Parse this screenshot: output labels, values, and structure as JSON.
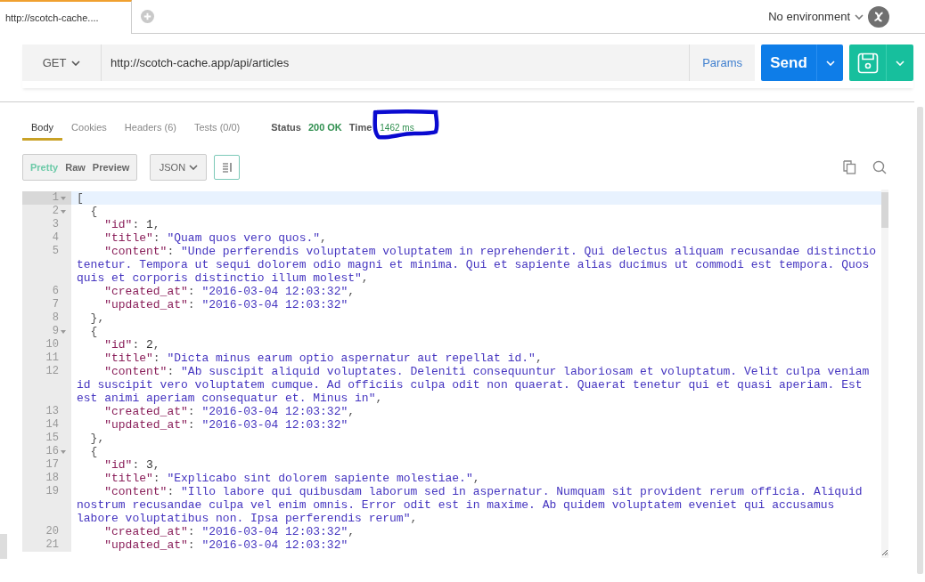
{
  "request_tabs": [
    {
      "label": "http://scotch-cache....",
      "selected": true
    }
  ],
  "environment": {
    "label": "No environment"
  },
  "request": {
    "method": "GET",
    "url": "http://scotch-cache.app/api/articles",
    "params_label": "Params",
    "send_label": "Send"
  },
  "response": {
    "tabs": [
      {
        "label": "Body",
        "selected": true
      },
      {
        "label": "Cookies",
        "selected": false
      },
      {
        "label": "Headers (6)",
        "selected": false
      },
      {
        "label": "Tests (0/0)",
        "selected": false
      }
    ],
    "status_label": "Status",
    "status_value": "200 OK",
    "time_label": "Time",
    "time_value": "1462 ms",
    "view_modes": [
      {
        "label": "Pretty",
        "selected": true
      },
      {
        "label": "Raw",
        "selected": false
      },
      {
        "label": "Preview",
        "selected": false
      }
    ],
    "format": "JSON",
    "lines": [
      {
        "number": "1",
        "fold": true,
        "active": true,
        "rows": [
          {
            "tokens": [
              {
                "kind": "punct",
                "text": "["
              }
            ]
          }
        ]
      },
      {
        "number": "2",
        "fold": true,
        "active": false,
        "rows": [
          {
            "tokens": [
              {
                "kind": "punct",
                "text": "  {"
              }
            ]
          }
        ]
      },
      {
        "number": "3",
        "fold": false,
        "active": false,
        "rows": [
          {
            "tokens": [
              {
                "kind": "key",
                "text": "    \"id\""
              },
              {
                "kind": "punct",
                "text": ": "
              },
              {
                "kind": "number",
                "text": "1"
              },
              {
                "kind": "punct",
                "text": ","
              }
            ]
          }
        ]
      },
      {
        "number": "4",
        "fold": false,
        "active": false,
        "rows": [
          {
            "tokens": [
              {
                "kind": "key",
                "text": "    \"title\""
              },
              {
                "kind": "punct",
                "text": ": "
              },
              {
                "kind": "string",
                "text": "\"Quam quos vero quos.\""
              },
              {
                "kind": "punct",
                "text": ","
              }
            ]
          }
        ]
      },
      {
        "number": "5",
        "fold": false,
        "active": false,
        "rows": [
          {
            "tokens": [
              {
                "kind": "key",
                "text": "    \"content\""
              },
              {
                "kind": "punct",
                "text": ": "
              },
              {
                "kind": "string",
                "text": "\"Unde perferendis voluptatem voluptatem in reprehenderit. Qui delectus aliquam recusandae distinctio"
              }
            ]
          },
          {
            "tokens": [
              {
                "kind": "string",
                "text": "tenetur. Tempora ut sequi dolorem odio magni et minima. Qui et sapiente alias ducimus ut commodi est tempora. Quos"
              }
            ]
          },
          {
            "tokens": [
              {
                "kind": "string",
                "text": "quis et corporis distinctio illum molest\""
              },
              {
                "kind": "punct",
                "text": ","
              }
            ]
          }
        ]
      },
      {
        "number": "6",
        "fold": false,
        "active": false,
        "rows": [
          {
            "tokens": [
              {
                "kind": "key",
                "text": "    \"created_at\""
              },
              {
                "kind": "punct",
                "text": ": "
              },
              {
                "kind": "string",
                "text": "\"2016-03-04 12:03:32\""
              },
              {
                "kind": "punct",
                "text": ","
              }
            ]
          }
        ]
      },
      {
        "number": "7",
        "fold": false,
        "active": false,
        "rows": [
          {
            "tokens": [
              {
                "kind": "key",
                "text": "    \"updated_at\""
              },
              {
                "kind": "punct",
                "text": ": "
              },
              {
                "kind": "string",
                "text": "\"2016-03-04 12:03:32\""
              }
            ]
          }
        ]
      },
      {
        "number": "8",
        "fold": false,
        "active": false,
        "rows": [
          {
            "tokens": [
              {
                "kind": "punct",
                "text": "  },"
              }
            ]
          }
        ]
      },
      {
        "number": "9",
        "fold": true,
        "active": false,
        "rows": [
          {
            "tokens": [
              {
                "kind": "punct",
                "text": "  {"
              }
            ]
          }
        ]
      },
      {
        "number": "10",
        "fold": false,
        "active": false,
        "rows": [
          {
            "tokens": [
              {
                "kind": "key",
                "text": "    \"id\""
              },
              {
                "kind": "punct",
                "text": ": "
              },
              {
                "kind": "number",
                "text": "2"
              },
              {
                "kind": "punct",
                "text": ","
              }
            ]
          }
        ]
      },
      {
        "number": "11",
        "fold": false,
        "active": false,
        "rows": [
          {
            "tokens": [
              {
                "kind": "key",
                "text": "    \"title\""
              },
              {
                "kind": "punct",
                "text": ": "
              },
              {
                "kind": "string",
                "text": "\"Dicta minus earum optio aspernatur aut repellat id.\""
              },
              {
                "kind": "punct",
                "text": ","
              }
            ]
          }
        ]
      },
      {
        "number": "12",
        "fold": false,
        "active": false,
        "rows": [
          {
            "tokens": [
              {
                "kind": "key",
                "text": "    \"content\""
              },
              {
                "kind": "punct",
                "text": ": "
              },
              {
                "kind": "string",
                "text": "\"Ab suscipit aliquid voluptates. Deleniti consequuntur laboriosam et voluptatum. Velit culpa veniam"
              }
            ]
          },
          {
            "tokens": [
              {
                "kind": "string",
                "text": "id suscipit vero voluptatem cumque. Ad officiis culpa odit non quaerat. Quaerat tenetur qui et quasi aperiam. Est"
              }
            ]
          },
          {
            "tokens": [
              {
                "kind": "string",
                "text": "est animi aperiam consequatur et. Minus in\""
              },
              {
                "kind": "punct",
                "text": ","
              }
            ]
          }
        ]
      },
      {
        "number": "13",
        "fold": false,
        "active": false,
        "rows": [
          {
            "tokens": [
              {
                "kind": "key",
                "text": "    \"created_at\""
              },
              {
                "kind": "punct",
                "text": ": "
              },
              {
                "kind": "string",
                "text": "\"2016-03-04 12:03:32\""
              },
              {
                "kind": "punct",
                "text": ","
              }
            ]
          }
        ]
      },
      {
        "number": "14",
        "fold": false,
        "active": false,
        "rows": [
          {
            "tokens": [
              {
                "kind": "key",
                "text": "    \"updated_at\""
              },
              {
                "kind": "punct",
                "text": ": "
              },
              {
                "kind": "string",
                "text": "\"2016-03-04 12:03:32\""
              }
            ]
          }
        ]
      },
      {
        "number": "15",
        "fold": false,
        "active": false,
        "rows": [
          {
            "tokens": [
              {
                "kind": "punct",
                "text": "  },"
              }
            ]
          }
        ]
      },
      {
        "number": "16",
        "fold": true,
        "active": false,
        "rows": [
          {
            "tokens": [
              {
                "kind": "punct",
                "text": "  {"
              }
            ]
          }
        ]
      },
      {
        "number": "17",
        "fold": false,
        "active": false,
        "rows": [
          {
            "tokens": [
              {
                "kind": "key",
                "text": "    \"id\""
              },
              {
                "kind": "punct",
                "text": ": "
              },
              {
                "kind": "number",
                "text": "3"
              },
              {
                "kind": "punct",
                "text": ","
              }
            ]
          }
        ]
      },
      {
        "number": "18",
        "fold": false,
        "active": false,
        "rows": [
          {
            "tokens": [
              {
                "kind": "key",
                "text": "    \"title\""
              },
              {
                "kind": "punct",
                "text": ": "
              },
              {
                "kind": "string",
                "text": "\"Explicabo sint dolorem sapiente molestiae.\""
              },
              {
                "kind": "punct",
                "text": ","
              }
            ]
          }
        ]
      },
      {
        "number": "19",
        "fold": false,
        "active": false,
        "rows": [
          {
            "tokens": [
              {
                "kind": "key",
                "text": "    \"content\""
              },
              {
                "kind": "punct",
                "text": ": "
              },
              {
                "kind": "string",
                "text": "\"Illo labore qui quibusdam laborum sed in aspernatur. Numquam sit provident rerum officia. Aliquid"
              }
            ]
          },
          {
            "tokens": [
              {
                "kind": "string",
                "text": "nostrum recusandae culpa vel enim omnis. Error odit est in maxime. Ab quidem voluptatem eveniet qui accusamus"
              }
            ]
          },
          {
            "tokens": [
              {
                "kind": "string",
                "text": "labore voluptatibus non. Ipsa perferendis rerum\""
              },
              {
                "kind": "punct",
                "text": ","
              }
            ]
          }
        ]
      },
      {
        "number": "20",
        "fold": false,
        "active": false,
        "rows": [
          {
            "tokens": [
              {
                "kind": "key",
                "text": "    \"created_at\""
              },
              {
                "kind": "punct",
                "text": ": "
              },
              {
                "kind": "string",
                "text": "\"2016-03-04 12:03:32\""
              },
              {
                "kind": "punct",
                "text": ","
              }
            ]
          }
        ]
      },
      {
        "number": "21",
        "fold": false,
        "active": false,
        "rows": [
          {
            "tokens": [
              {
                "kind": "key",
                "text": "    \"updated_at\""
              },
              {
                "kind": "punct",
                "text": ": "
              },
              {
                "kind": "string",
                "text": "\"2016-03-04 12:03:32\""
              }
            ]
          }
        ]
      }
    ]
  }
}
